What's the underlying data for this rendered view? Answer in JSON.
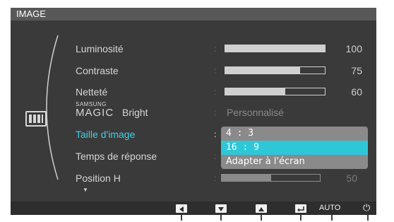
{
  "window": {
    "title": "IMAGE"
  },
  "menu": {
    "items": [
      {
        "label": "Luminosité"
      },
      {
        "label": "Contraste"
      },
      {
        "label": "Netteté"
      },
      {
        "label": "Bright",
        "brand_small": "SAMSUNG",
        "brand_large": "MAGIC"
      },
      {
        "label": "Taille d'image"
      },
      {
        "label": "Temps de réponse"
      },
      {
        "label": "Position H"
      }
    ]
  },
  "settings": {
    "brightness": {
      "value": "100",
      "level": 1.0
    },
    "contrast": {
      "value": "75",
      "level": 0.75
    },
    "sharpness": {
      "value": "60",
      "level": 0.6
    },
    "magic_bright": {
      "value": "Personnalisé"
    },
    "position_h": {
      "value": "50",
      "level": 0.5
    }
  },
  "dropdown": {
    "options": [
      {
        "label": "4 : 3",
        "selected": false
      },
      {
        "label": "16 : 9",
        "selected": true
      },
      {
        "label": "Adapter à l'écran",
        "selected": false
      }
    ]
  },
  "colon": ":",
  "bottom_bar": {
    "auto_label": "AUTO",
    "power_glyph": "⏻"
  },
  "colors": {
    "accent": "#40d0e8",
    "highlight": "#2ec7d8",
    "panel": "#3a3a3a",
    "title": "#585858"
  }
}
